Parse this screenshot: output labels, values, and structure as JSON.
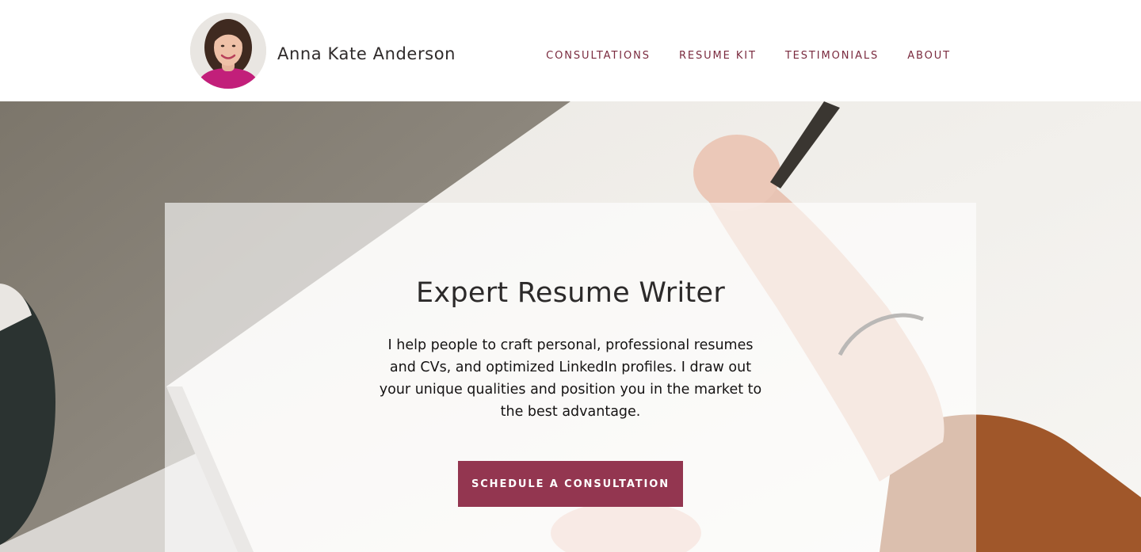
{
  "header": {
    "site_name": "Anna Kate Anderson",
    "nav": [
      {
        "label": "CONSULTATIONS"
      },
      {
        "label": "RESUME KIT"
      },
      {
        "label": "TESTIMONIALS"
      },
      {
        "label": "ABOUT"
      }
    ]
  },
  "hero": {
    "title": "Expert Resume Writer",
    "text": "I help people to craft personal, professional resumes and CVs, and optimized LinkedIn profiles. I draw out your unique qualities and position you in the market to the best advantage.",
    "cta_label": "SCHEDULE A CONSULTATION"
  },
  "colors": {
    "accent": "#933650",
    "nav_text": "#7a2a3e",
    "heading": "#2c2a2a"
  }
}
